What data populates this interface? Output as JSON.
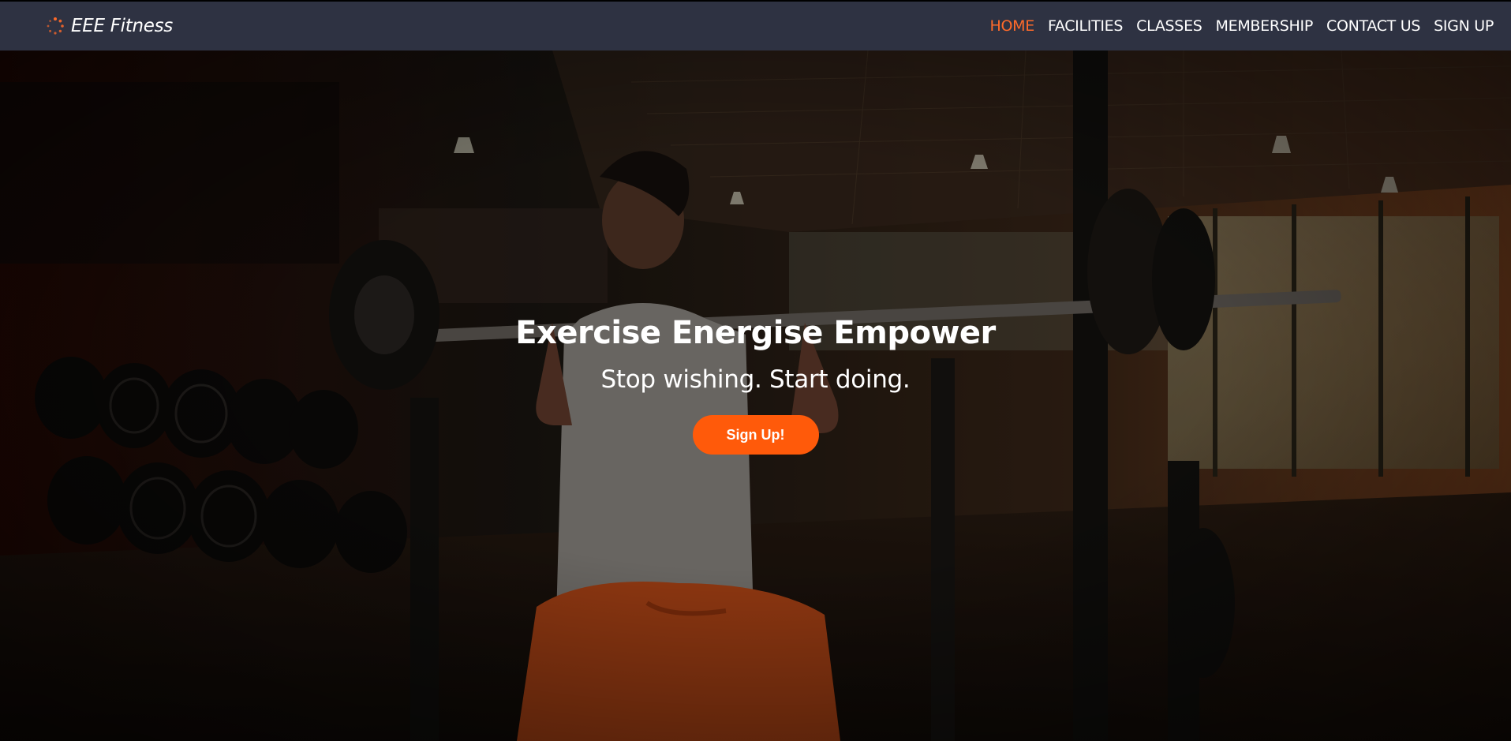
{
  "brand": {
    "name": "EEE Fitness",
    "icon": "spinner-dots-icon",
    "accent_color": "#ff6a2a"
  },
  "nav": {
    "items": [
      {
        "label": "HOME",
        "active": true
      },
      {
        "label": "FACILITIES",
        "active": false
      },
      {
        "label": "CLASSES",
        "active": false
      },
      {
        "label": "MEMBERSHIP",
        "active": false
      },
      {
        "label": "CONTACT US",
        "active": false
      },
      {
        "label": "SIGN UP",
        "active": false
      }
    ],
    "background": "#2e3242",
    "active_color": "#ff6a2a"
  },
  "hero": {
    "title": "Exercise Energise Empower",
    "subtitle": "Stop wishing. Start doing.",
    "cta_label": "Sign Up!",
    "cta_color": "#ff5a0a",
    "image": "gym-woman-barbell-squat-photo"
  }
}
